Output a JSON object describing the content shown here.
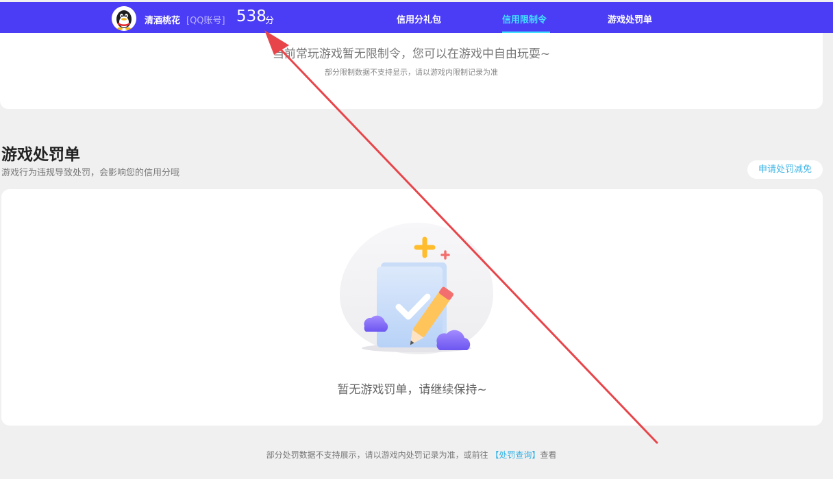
{
  "header": {
    "nickname": "清酒桃花",
    "account_type": "[QQ账号]",
    "score": "538",
    "score_unit": "分",
    "tabs": [
      {
        "label": "信用分礼包",
        "active": false
      },
      {
        "label": "信用限制令",
        "active": true
      },
      {
        "label": "游戏处罚单",
        "active": false
      }
    ]
  },
  "restriction": {
    "message": "当前常玩游戏暂无限制令，您可以在游戏中自由玩耍~",
    "note": "部分限制数据不支持显示，请以游戏内限制记录为准"
  },
  "penalty": {
    "title": "游戏处罚单",
    "subtitle": "游戏行为违规导致处罚，会影响您的信用分哦",
    "appeal_button": "申请处罚减免",
    "empty_text": "暂无游戏罚单，请继续保持~"
  },
  "footer": {
    "note_prefix": "部分处罚数据不支持展示，请以游戏内处罚记录为准，或前往",
    "link_text": "【处罚查询】",
    "note_suffix": "查看"
  },
  "colors": {
    "nav_bg": "#4b3cf6",
    "active_tab": "#41e2ff",
    "link": "#2fb1e6",
    "annotation_arrow": "#e8454a"
  },
  "icons": {
    "avatar": "qq-penguin-icon",
    "empty_state": "empty-penalty-illustration",
    "annotation": "red-arrow-icon"
  }
}
